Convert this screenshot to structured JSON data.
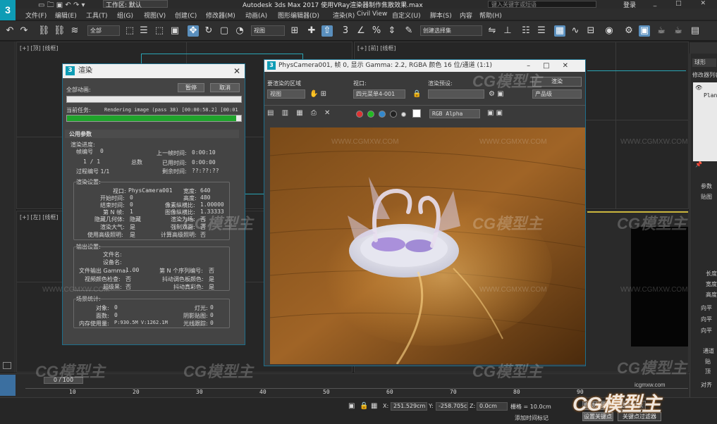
{
  "window": {
    "title": "Autodesk 3ds Max 2017    使用VRay渲染器制作焦散效果.max",
    "workspace_label": "工作区: 默认",
    "search_placeholder": "键入关键字或短语",
    "login_label": "登录",
    "win_buttons": "_ □ ✕"
  },
  "menubar": {
    "items": [
      "文件(F)",
      "编辑(E)",
      "工具(T)",
      "组(G)",
      "视图(V)",
      "创建(C)",
      "修改器(M)",
      "动画(A)",
      "图形编辑器(D)",
      "渲染(R)",
      "Civil View",
      "自定义(U)",
      "脚本(S)",
      "内容",
      "帮助(H)"
    ]
  },
  "toolbar": {
    "filter_dropdown": "全部",
    "ref_coord_dropdown": "视图",
    "selection_set_dropdown": "创建选择集"
  },
  "viewports": {
    "top_left_label": "[+] [顶] [线框]",
    "top_right_label": "[+] [前] [线框]",
    "left_label": "[+] [左] [线框]"
  },
  "command_panel": {
    "sphere_label": "球形",
    "modifier_list": "修改器列表",
    "plane_label": "Plane",
    "params_label": "参数",
    "map_label": "贴图",
    "length_label": "长度",
    "width_label": "宽度",
    "height_label": "高度",
    "dir1": "向平",
    "dir2": "向平",
    "dir3": "向平",
    "channel_label": "通道",
    "ch1": "贴",
    "ch2": "顶",
    "align_label": "对齐"
  },
  "render_dialog": {
    "title": "渲染",
    "all_anim_label": "全部动画:",
    "pause_button": "暂停",
    "cancel_button": "取消",
    "current_task_label": "当前任务:",
    "current_task_value": "Rendering image (pass 38) [00:00:58.2] [00:01",
    "all_progress": 0.0,
    "task_progress": 0.97,
    "section_title": "公用参数",
    "render_progress_label": "渲染进度:",
    "frame_no_label": "帧编号",
    "frame_no": "0",
    "last_frame_time_label": "上一帧时间:",
    "last_frame_time": "0:00:10",
    "frames_label": "1 / 1",
    "total_label": "总数",
    "elapsed_label": "已用时间:",
    "elapsed_time": "0:00:00",
    "pass_label": "过程编号 1/1",
    "remaining_label": "剩余时间:",
    "remaining_time": "??:??:??",
    "render_settings_label": "渲染设置:",
    "viewport_label": "视口:",
    "viewport_value": "PhysCamera001",
    "width_label": "宽度:",
    "width_value": "640",
    "start_time_label": "开始时间:",
    "start_time": "0",
    "height_label": "高度:",
    "height_value": "480",
    "end_time_label": "结束时间:",
    "end_time": "0",
    "pixel_aspect_label": "像素纵横比:",
    "pixel_aspect": "1.00000",
    "nth_frame_label": "第 N 帧:",
    "nth_frame": "1",
    "image_aspect_label": "图像纵横比:",
    "image_aspect": "1.33333",
    "hidden_geom_label": "隐藏几何体:",
    "hidden_geom": "隐藏",
    "render_fields_label": "渲染为场:",
    "render_fields": "否",
    "atmos_label": "渲染大气:",
    "atmos": "是",
    "force_2sided_label": "强制双面:",
    "force_2sided": "否",
    "adv_lighting_label": "使用高级照明:",
    "adv_lighting": "是",
    "compute_adv_label": "计算高级照明:",
    "compute_adv": "否",
    "output_settings_label": "输出设置:",
    "file_name_label": "文件名:",
    "device_name_label": "设备名:",
    "file_gamma_label": "文件输出 Gamma:",
    "file_gamma": "1.00",
    "nth_serial_label": "第 N 个序列编号:",
    "nth_serial": "否",
    "video_check_label": "视频颜色检查:",
    "video_check": "否",
    "dither_palette_label": "抖动调色板颜色:",
    "dither_palette": "是",
    "super_black_label": "超级黑:",
    "super_black": "否",
    "dither_true_label": "抖动真彩色:",
    "dither_true": "是",
    "scene_stats_label": "场景统计:",
    "objects_label": "对象:",
    "objects": "0",
    "lights_label": "灯光:",
    "lights": "0",
    "faces_label": "面数:",
    "faces": "0",
    "shadow_label": "阴影贴图:",
    "shadow": "0",
    "memory_label": "内存使用量:",
    "memory": "P:930.5M V:1262.1M",
    "raytraced_label": "光线跟踪:",
    "raytraced": "0"
  },
  "frame_buffer": {
    "title": "PhysCamera001, 帧 0, 显示 Gamma: 2.2, RGBA 颜色 16 位/通道 (1:1)",
    "render_area_label": "要渲染的区域",
    "render_area_value": "视图",
    "viewport_label": "视口:",
    "viewport_value": "四元菜单4-001",
    "preset_label": "渲染预设:",
    "preset_value": "",
    "render_button": "渲染",
    "product_label": "产品级",
    "channel_value": "RGB Alpha"
  },
  "timeline": {
    "frame_indicator": "0 / 100",
    "ticks": [
      "10",
      "20",
      "30",
      "40",
      "50",
      "60",
      "70",
      "80",
      "90"
    ]
  },
  "statusbar": {
    "x_label": "X:",
    "x_value": "251.529cm",
    "y_label": "Y:",
    "y_value": "-258.705c",
    "z_label": "Z:",
    "z_value": "0.0cm",
    "grid_label": "栅格 = 10.0cm",
    "add_time_tag": "添加时间标记",
    "auto_key": "自动关键点",
    "set_key": "设置关键点",
    "selected": "选定对象",
    "key_filters": "关键点过滤器"
  },
  "watermarks": {
    "brand": "CG模型主",
    "url": "WWW.CGMXW.COM",
    "url_small": "icgmxw.com"
  }
}
